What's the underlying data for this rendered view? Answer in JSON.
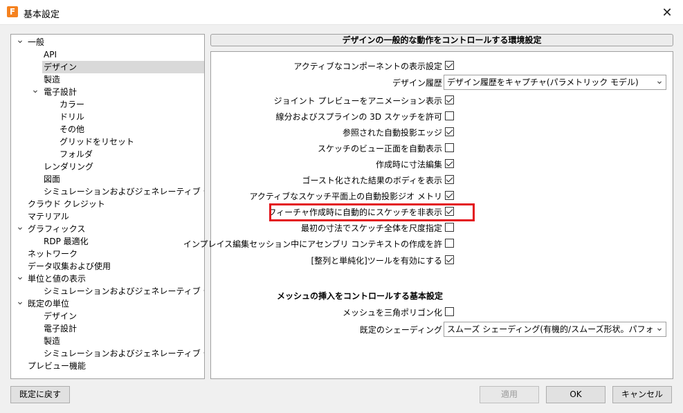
{
  "window": {
    "title": "基本設定",
    "app_icon_letter": "F"
  },
  "tree": [
    {
      "label": "一般",
      "level": 0,
      "expanded": true
    },
    {
      "label": "API",
      "level": 1
    },
    {
      "label": "デザイン",
      "level": 1,
      "selected": true
    },
    {
      "label": "製造",
      "level": 1
    },
    {
      "label": "電子設計",
      "level": 1,
      "expanded": true
    },
    {
      "label": "カラー",
      "level": 2
    },
    {
      "label": "ドリル",
      "level": 2
    },
    {
      "label": "その他",
      "level": 2
    },
    {
      "label": "グリッドをリセット",
      "level": 2
    },
    {
      "label": "フォルダ",
      "level": 2
    },
    {
      "label": "レンダリング",
      "level": 1
    },
    {
      "label": "図面",
      "level": 1
    },
    {
      "label": "シミュレーションおよびジェネレーティブ デザ...",
      "level": 1
    },
    {
      "label": "クラウド クレジット",
      "level": 0
    },
    {
      "label": "マテリアル",
      "level": 0
    },
    {
      "label": "グラフィックス",
      "level": 0,
      "expanded": true
    },
    {
      "label": "RDP 最適化",
      "level": 1
    },
    {
      "label": "ネットワーク",
      "level": 0
    },
    {
      "label": "データ収集および使用",
      "level": 0
    },
    {
      "label": "単位と値の表示",
      "level": 0,
      "expanded": true
    },
    {
      "label": "シミュレーションおよびジェネレーティブ デザ...",
      "level": 1
    },
    {
      "label": "既定の単位",
      "level": 0,
      "expanded": true
    },
    {
      "label": "デザイン",
      "level": 1
    },
    {
      "label": "電子設計",
      "level": 1
    },
    {
      "label": "製造",
      "level": 1
    },
    {
      "label": "シミュレーションおよびジェネレーティブ デザ...",
      "level": 1
    },
    {
      "label": "プレビュー機能",
      "level": 0
    }
  ],
  "panel": {
    "header": "デザインの一般的な動作をコントロールする環境設定",
    "options": [
      {
        "label": "アクティブなコンポーネントの表示設定",
        "type": "checkbox",
        "checked": true
      },
      {
        "label": "デザイン履歴",
        "type": "select",
        "value": "デザイン履歴をキャプチャ(パラメトリック モデル)"
      },
      {
        "label": "ジョイント プレビューをアニメーション表示",
        "type": "checkbox",
        "checked": true
      },
      {
        "label": "線分およびスプラインの 3D スケッチを許可",
        "type": "checkbox",
        "checked": false
      },
      {
        "label": "参照された自動投影エッジ",
        "type": "checkbox",
        "checked": true
      },
      {
        "label": "スケッチのビュー正面を自動表示",
        "type": "checkbox",
        "checked": false
      },
      {
        "label": "作成時に寸法編集",
        "type": "checkbox",
        "checked": true
      },
      {
        "label": "ゴースト化された結果のボディを表示",
        "type": "checkbox",
        "checked": true
      },
      {
        "label": "アクティブなスケッチ平面上の自動投影ジオ メトリ",
        "type": "checkbox",
        "checked": true
      },
      {
        "label": "フィーチャ作成時に自動的にスケッチを非表示",
        "type": "checkbox",
        "checked": true,
        "highlighted": true
      },
      {
        "label": "最初の寸法でスケッチ全体を尺度指定",
        "type": "checkbox",
        "checked": false
      },
      {
        "label": "インプレイス編集セッション中にアセンブリ コンテキストの作成を許",
        "type": "checkbox",
        "checked": false
      },
      {
        "label": "[整列と単純化]ツールを有効にする",
        "type": "checkbox",
        "checked": true
      }
    ],
    "mesh_section_title": "メッシュの挿入をコントロールする基本設定",
    "mesh_options": [
      {
        "label": "メッシュを三角ポリゴン化",
        "type": "checkbox",
        "checked": false
      },
      {
        "label": "既定のシェーディング",
        "type": "select",
        "value": "スムーズ シェーディング(有機的/スムーズ形状。パフォーマン"
      }
    ]
  },
  "buttons": {
    "reset": "既定に戻す",
    "apply": "適用",
    "ok": "OK",
    "cancel": "キャンセル"
  },
  "colors": {
    "highlight": "#e3141b",
    "app_icon": "#f5821f",
    "selected_tree_item": "#d9d9d9"
  }
}
